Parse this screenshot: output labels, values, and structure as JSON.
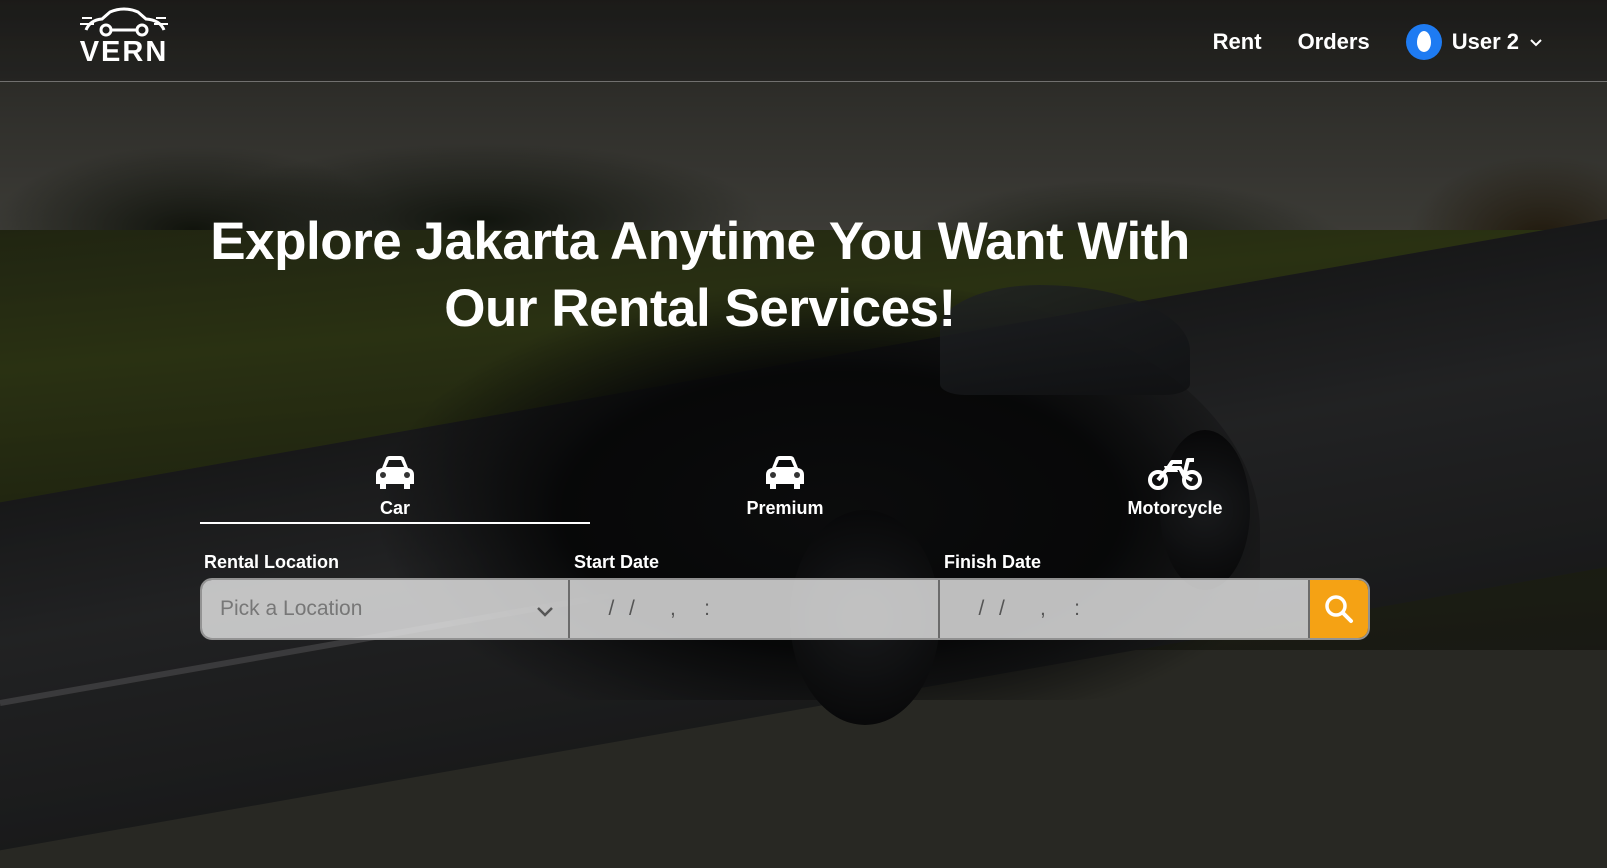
{
  "header": {
    "logo_text": "VERN",
    "nav": [
      {
        "label": "Rent"
      },
      {
        "label": "Orders"
      }
    ],
    "user": {
      "name": "User 2",
      "avatar_icon": "droplet-icon",
      "dropdown_icon": "chevron-down-icon"
    }
  },
  "hero": {
    "title_line1": "Explore Jakarta Anytime You Want With",
    "title_line2": "Our Rental Services!"
  },
  "tabs": [
    {
      "label": "Car",
      "icon": "car-icon",
      "active": true
    },
    {
      "label": "Premium",
      "icon": "car-icon",
      "active": false
    },
    {
      "label": "Motorcycle",
      "icon": "motorcycle-icon",
      "active": false
    }
  ],
  "search": {
    "location_label": "Rental Location",
    "location_placeholder": "Pick a Location",
    "start_label": "Start Date",
    "start_mask": "   /  /     ,    :   ",
    "finish_label": "Finish Date",
    "finish_mask": "   /  /     ,    :   ",
    "button_icon": "search-icon"
  },
  "colors": {
    "accent": "#f5a214",
    "avatar": "#1e7bf2"
  }
}
